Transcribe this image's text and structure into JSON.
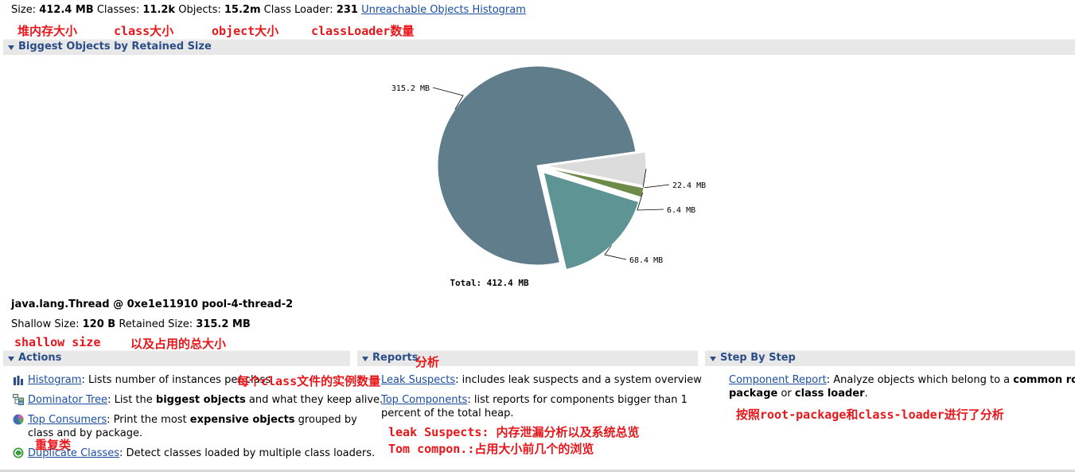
{
  "summary": {
    "size_label": "Size:",
    "size_value": "412.4 MB",
    "classes_label": "Classes:",
    "classes_value": "11.2k",
    "objects_label": "Objects:",
    "objects_value": "15.2m",
    "loader_label": "Class Loader:",
    "loader_value": "231",
    "unreachable_link": "Unreachable Objects Histogram"
  },
  "annotations": {
    "heap_size": "堆内存大小",
    "class_size": "class大小",
    "object_size": "object大小",
    "classloader_count": "classLoader数量",
    "shallow_size": "shallow size",
    "total_occupied": "以及占用的总大小",
    "reports": "分析",
    "instances_per_class": "每个class文件的实例数量",
    "duplicate": "重复类",
    "leak_note": "leak Suspects: 内存泄漏分析以及系统总览",
    "top_note": "Tom compon.:占用大小前几个的浏览",
    "step_note": "按照root-package和class-loader进行了分析"
  },
  "biggest_objects": {
    "section_title": "Biggest Objects by Retained Size",
    "selected_object": "java.lang.Thread @ 0xe1e11910 pool-4-thread-2",
    "shallow_label": "Shallow Size:",
    "shallow_value": "120 B",
    "retained_label": "Retained Size:",
    "retained_value": "315.2 MB"
  },
  "chart_data": {
    "type": "pie",
    "total_label": "Total: 412.4 MB",
    "slices": [
      {
        "label": "315.2 MB",
        "value": 315.2,
        "color": "#607d8b",
        "exploded": false
      },
      {
        "label": "22.4 MB",
        "value": 22.4,
        "color": "#dcdcdc",
        "exploded": true
      },
      {
        "label": "6.4 MB",
        "value": 6.4,
        "color": "#6e8b4a",
        "exploded": true
      },
      {
        "label": "68.4 MB",
        "value": 68.4,
        "color": "#5e9494",
        "exploded": true
      }
    ]
  },
  "actions": {
    "title": "Actions",
    "items": [
      {
        "link": "Histogram",
        "text_pre": ": Lists number of instances per class",
        "bold": "",
        "text_post": "",
        "icon": "histogram-icon"
      },
      {
        "link": "Dominator Tree",
        "text_pre": ": List the ",
        "bold": "biggest objects",
        "text_post": " and what they keep alive.",
        "icon": "dominator-tree-icon"
      },
      {
        "link": "Top Consumers",
        "text_pre": ": Print the most ",
        "bold": "expensive objects",
        "text_post": " grouped by",
        "line2": "class and by package.",
        "icon": "pie-chart-icon"
      },
      {
        "link": "Duplicate Classes",
        "text_pre": ": Detect classes loaded by multiple class loaders.",
        "bold": "",
        "text_post": "",
        "icon": "duplicate-classes-icon"
      }
    ]
  },
  "reports": {
    "title": "Reports",
    "items": [
      {
        "link": "Leak Suspects",
        "text": ": includes leak suspects and a system overview"
      },
      {
        "link": "Top Components",
        "text": ": list reports for components bigger than 1",
        "line2": "percent of the total heap."
      }
    ]
  },
  "step_by_step": {
    "title": "Step By Step",
    "link": "Component Report",
    "text_pre": ": Analyze objects which belong to a ",
    "bold1": "common root",
    "bold2": "package",
    "text_mid": " or ",
    "bold3": "class loader",
    "text_post": "."
  }
}
